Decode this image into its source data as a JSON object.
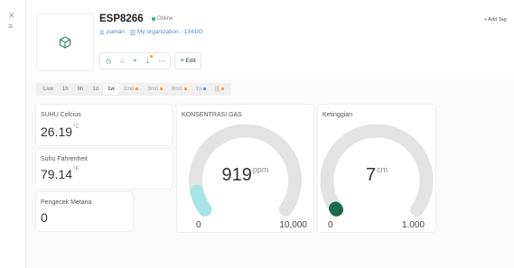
{
  "rail": {
    "close_icon": "close-icon",
    "menu_icon": "hamburger-icon"
  },
  "device": {
    "title": "ESP8266",
    "status": "Online",
    "owner": "paman",
    "organization": "My organization - 1341IG"
  },
  "toolbar": {
    "icons": [
      "clock-icon",
      "bell-icon",
      "location-icon",
      "chart-upload-icon",
      "more-icon"
    ],
    "edit_label": "Edit"
  },
  "header": {
    "add_tag_label": "+ Add Tag"
  },
  "time_tabs": [
    {
      "label": "Live",
      "active": false,
      "locked": false
    },
    {
      "label": "1h",
      "active": false,
      "locked": false
    },
    {
      "label": "6h",
      "active": false,
      "locked": false
    },
    {
      "label": "1d",
      "active": false,
      "locked": false
    },
    {
      "label": "1w",
      "active": true,
      "locked": false
    },
    {
      "label": "1mo",
      "active": false,
      "locked": true,
      "dot": "#f39c12"
    },
    {
      "label": "3mo",
      "active": false,
      "locked": true,
      "dot": "#f39c12"
    },
    {
      "label": "6mo",
      "active": false,
      "locked": true,
      "dot": "#f39c12"
    },
    {
      "label": "1y",
      "active": false,
      "locked": true,
      "dot": "#4b8fcc"
    },
    {
      "label": "|||",
      "active": false,
      "locked": true,
      "dot": "#f39c12"
    }
  ],
  "widgets": {
    "celcius": {
      "title": "SUHU Celcius",
      "value": "26.19",
      "unit": "°C"
    },
    "fahrenheit": {
      "title": "Suhu Fahrenheit",
      "value": "79.14",
      "unit": "°F"
    },
    "methane": {
      "title": "Pengecek Metana",
      "value": "0"
    },
    "gas": {
      "title": "KONSENTRASI GAS",
      "value": "919",
      "unit": "ppm",
      "min": "0",
      "max": "10,000",
      "fraction": 0.0919,
      "color": "#a8e3e8"
    },
    "height": {
      "title": "Ketinggian",
      "value": "7",
      "unit": "cm",
      "min": "0",
      "max": "1.000",
      "fraction": 0.007,
      "color": "#1c6b4b"
    }
  }
}
